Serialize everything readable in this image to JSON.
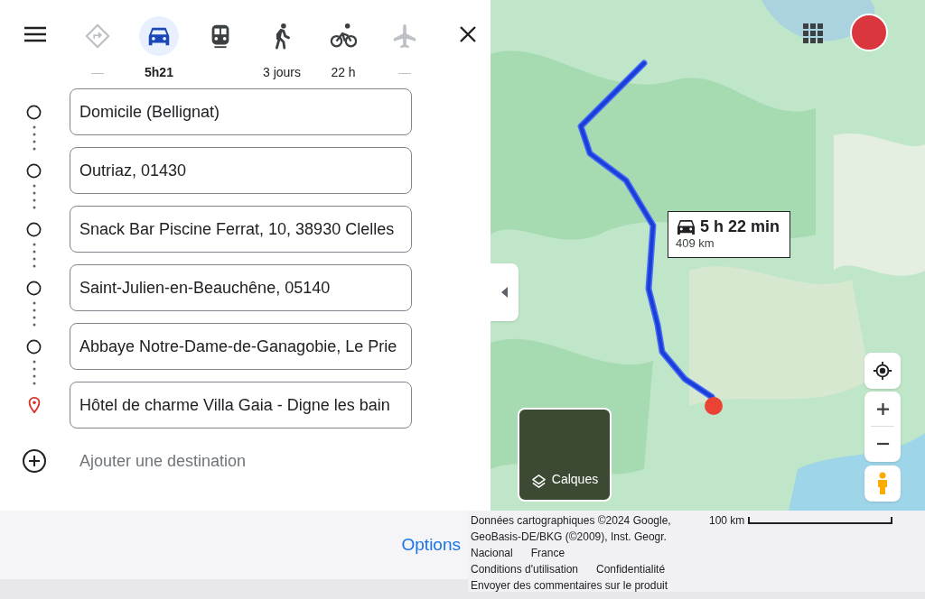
{
  "modes": [
    {
      "kind": "best",
      "label": "—",
      "selected": false,
      "disabled": true
    },
    {
      "kind": "car",
      "label": "5h21",
      "selected": true,
      "disabled": false
    },
    {
      "kind": "transit",
      "selected": false,
      "disabled": false
    },
    {
      "kind": "walk",
      "label": "3 jours",
      "selected": false,
      "disabled": false
    },
    {
      "kind": "bike",
      "label": "22 h",
      "selected": false,
      "disabled": false
    },
    {
      "kind": "flight",
      "label": "—",
      "selected": false,
      "disabled": true
    }
  ],
  "stops": [
    {
      "kind": "stop",
      "value": "Domicile (Bellignat)"
    },
    {
      "kind": "stop",
      "value": "Outriaz, 01430"
    },
    {
      "kind": "stop",
      "value": "Snack Bar Piscine Ferrat, 10, 38930 Clelles"
    },
    {
      "kind": "stop",
      "value": "Saint-Julien-en-Beauchêne, 05140"
    },
    {
      "kind": "stop",
      "value": "Abbaye Notre-Dame-de-Ganagobie, Le Prie"
    },
    {
      "kind": "destination",
      "value": "Hôtel de charme Villa Gaia - Digne les bain"
    }
  ],
  "add_destination": "Ajouter une destination",
  "route_info": {
    "duration": "5 h 22 min",
    "distance": "409 km"
  },
  "layers_button": "Calques",
  "options": "Options",
  "attribution": {
    "data": "Données cartographiques ©2024 Google, GeoBasis-DE/BKG (©2009), Inst. Geogr. Nacional",
    "country": "France",
    "scale": "100 km",
    "links": [
      "Conditions d'utilisation",
      "Confidentialité"
    ],
    "feedback": "Envoyer des commentaires sur le produit"
  }
}
